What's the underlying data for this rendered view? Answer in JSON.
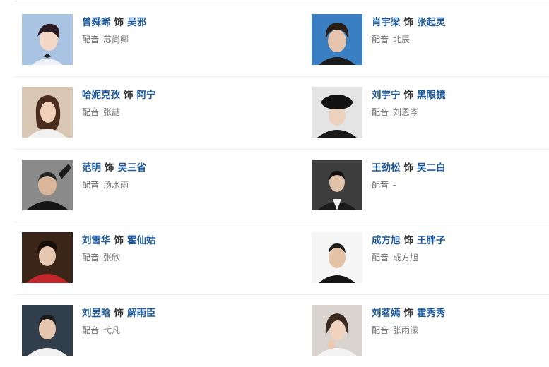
{
  "separator_label": "饰",
  "voice_label": "配音",
  "cast": [
    {
      "actor": "曾舜晞",
      "role": "吴邪",
      "voice": "苏尚卿"
    },
    {
      "actor": "肖宇梁",
      "role": "张起灵",
      "voice": "北辰"
    },
    {
      "actor": "哈妮克孜",
      "role": "阿宁",
      "voice": "张喆"
    },
    {
      "actor": "刘宇宁",
      "role": "黑眼镜",
      "voice": "刘恩岑"
    },
    {
      "actor": "范明",
      "role": "吴三省",
      "voice": "汤水雨"
    },
    {
      "actor": "王劲松",
      "role": "吴二白",
      "voice": "-"
    },
    {
      "actor": "刘雪华",
      "role": "霍仙姑",
      "voice": "张欣"
    },
    {
      "actor": "成方旭",
      "role": "王胖子",
      "voice": "成方旭"
    },
    {
      "actor": "刘昱晗",
      "role": "解雨臣",
      "voice": "弋凡"
    },
    {
      "actor": "刘茗嫣",
      "role": "霍秀秀",
      "voice": "张雨濛"
    }
  ]
}
